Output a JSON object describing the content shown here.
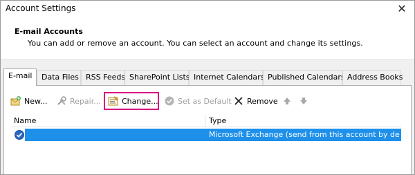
{
  "window": {
    "title": "Account Settings",
    "close_glyph": "✕"
  },
  "header": {
    "heading": "E-mail Accounts",
    "description": "You can add or remove an account. You can select an account and change its settings."
  },
  "tabs": [
    {
      "label": "E-mail",
      "active": true
    },
    {
      "label": "Data Files",
      "active": false
    },
    {
      "label": "RSS Feeds",
      "active": false
    },
    {
      "label": "SharePoint Lists",
      "active": false
    },
    {
      "label": "Internet Calendars",
      "active": false
    },
    {
      "label": "Published Calendars",
      "active": false
    },
    {
      "label": "Address Books",
      "active": false
    }
  ],
  "toolbar": {
    "new_label": "New...",
    "new_icon": "new-account-icon",
    "repair_label": "Repair...",
    "repair_icon": "tools-icon",
    "change_label": "Change...",
    "change_icon": "change-settings-icon",
    "set_default_label": "Set as Default",
    "set_default_icon": "checkmark-circle-icon",
    "remove_label": "Remove",
    "remove_icon": "x-icon",
    "move_up_icon": "arrow-up-icon",
    "move_down_icon": "arrow-down-icon"
  },
  "list": {
    "columns": [
      "Name",
      "Type"
    ],
    "rows": [
      {
        "name": "",
        "type": "Microsoft Exchange (send from this account by def...",
        "selected": true,
        "default_icon": "default-account-check-icon"
      }
    ]
  },
  "colors": {
    "selection": "#1e90ea",
    "highlight": "#d8157e"
  }
}
